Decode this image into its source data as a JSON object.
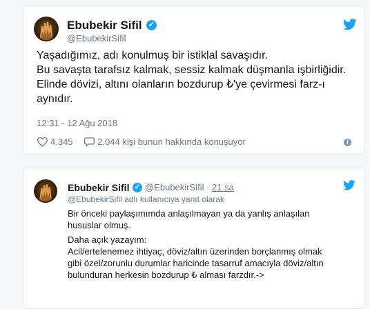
{
  "tweet": {
    "author_name": "Ebubekir Sifil",
    "author_handle": "@EbubekirSifil",
    "text_lines": [
      "Yaşadığımız, adı konulmuş bir istiklal savaşıdır.",
      "Bu savaşta tarafsız kalmak, sessiz kalmak düşmanla işbirliğidir.",
      "Elinde dövizi, altını olanların bozdurup ₺'ye çevirmesi farz-ı",
      "aynıdır."
    ],
    "timestamp": "12:31 - 12 Ağu 2018",
    "likes": "4.345",
    "replies_text": "2.044 kişi bunun hakkında konuşuyor"
  },
  "reply": {
    "author_name": "Ebubekir Sifil",
    "author_handle": "@EbubekirSifil",
    "separator": "·",
    "time": "21 sa",
    "reply_to": "@EbubekirSifil adlı kullanıcıya yanıt olarak",
    "paragraphs": [
      [
        "Bir önceki paylaşımımda anlaşılmayan ya da yanlış anlaşılan",
        "hususlar olmuş."
      ],
      [
        "Daha açık yazayım:",
        "Acil/ertelenemez ihtiyaç, döviz/altın üzerinden borçlanmış olmak",
        "gibi özel/zorunlu durumlar haricinde tasarruf amacıyla döviz/altın",
        "bulunduran herkesin bozdurup ₺ alması farzdır.->"
      ]
    ]
  },
  "colors": {
    "twitter_blue": "#1da1f2",
    "secondary_text": "#657786",
    "border": "#e1e8ed",
    "background": "#f5f8fa"
  },
  "icons": {
    "verified": "verified-badge-icon",
    "twitter": "twitter-bird-icon",
    "like": "heart-icon",
    "reply": "reply-bubble-icon",
    "info": "info-icon",
    "avatar": "avatar"
  }
}
